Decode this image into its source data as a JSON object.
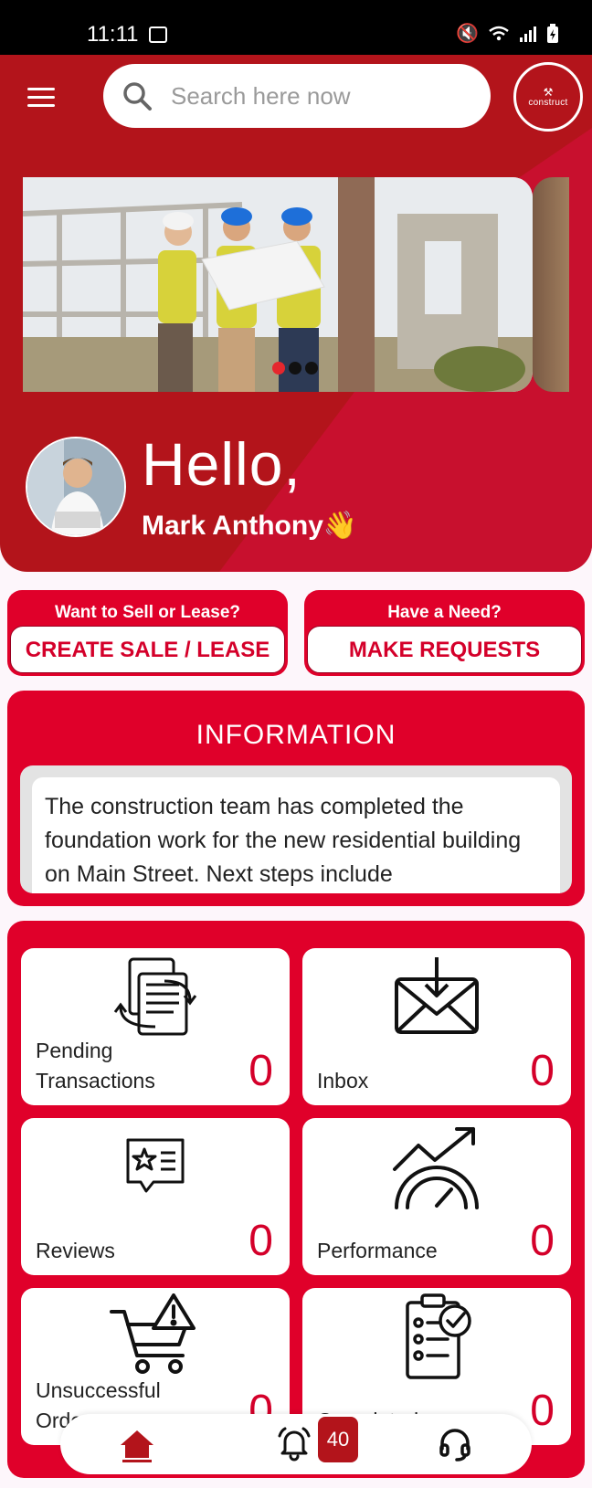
{
  "status_bar": {
    "time": "11:11",
    "icons": [
      "gallery-icon",
      "mute-icon",
      "wifi-icon",
      "signal-icon",
      "battery-icon"
    ]
  },
  "header": {
    "search_placeholder": "Search here now",
    "logo_text": "construct"
  },
  "banner": {
    "slide_count": 3,
    "active_slide": 1
  },
  "greeting": {
    "hello": "Hello,",
    "user_name": "Mark Anthony👋"
  },
  "actions": [
    {
      "caption": "Want to Sell or Lease?",
      "button": "CREATE SALE / LEASE"
    },
    {
      "caption": "Have a Need?",
      "button": "MAKE REQUESTS"
    }
  ],
  "information": {
    "title": "INFORMATION",
    "text": "The construction team has completed the foundation work for the new residential building on Main Street. Next steps include"
  },
  "tiles": [
    {
      "label": "Pending Transactions",
      "count": "0",
      "icon": "transactions-icon"
    },
    {
      "label": "Inbox",
      "count": "0",
      "icon": "inbox-icon"
    },
    {
      "label": "Reviews",
      "count": "0",
      "icon": "reviews-icon"
    },
    {
      "label": "Performance",
      "count": "0",
      "icon": "performance-icon"
    },
    {
      "label": "Unsuccessful Orders",
      "count": "0",
      "icon": "cart-warning-icon"
    },
    {
      "label": "Completed",
      "count": "0",
      "icon": "checklist-icon"
    }
  ],
  "bottom_nav": {
    "notification_count": "40"
  },
  "colors": {
    "primary": "#e0002a",
    "hero_dark": "#b3141b",
    "white": "#ffffff"
  }
}
